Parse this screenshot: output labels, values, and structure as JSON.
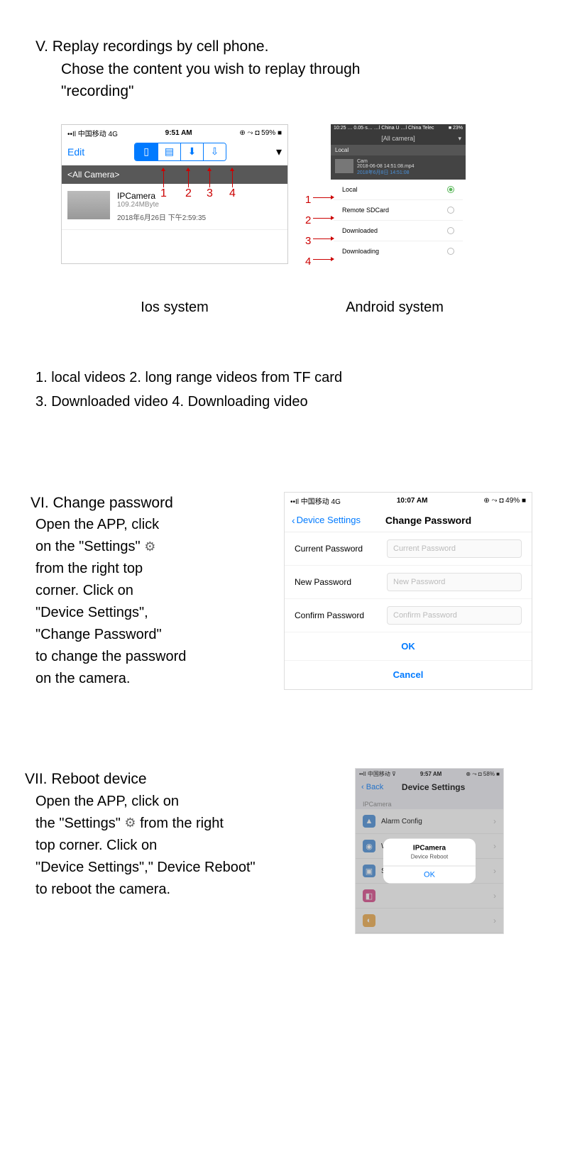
{
  "section5": {
    "heading_line1": "V.  Replay recordings by cell phone.",
    "heading_line2": "Chose the content you wish to replay through",
    "heading_line3": "\"recording\"",
    "ios_caption": "Ios system",
    "android_caption": "Android system",
    "legend1": "1.   local videos       2. long range videos from TF card",
    "legend2": "3.  Downloaded video       4.  Downloading video"
  },
  "ios_shot1": {
    "status_left": "••Il 中国移动  4G",
    "status_center": "9:51 AM",
    "status_right": "⊕ ⤳ ◘ 59% ■",
    "edit": "Edit",
    "breadcrumb": "<All Camera>",
    "video_name": "IPCamera",
    "video_size": "109.24MByte",
    "video_date": "2018年6月26日 下午2:59:35",
    "num1": "1",
    "num2": "2",
    "num3": "3",
    "num4": "4"
  },
  "android_shot": {
    "status_left": "10:25 … 0.05·s… …l China U  …l China Telec",
    "status_right": "■ 23%",
    "title": "[All camera]",
    "section": "Local",
    "item_name": "Cam",
    "item_line1": "2018-06-08 14:51:08.mp4",
    "item_line2": "2018年6月8日 14:51:08",
    "options": [
      "Local",
      "Remote SDCard",
      "Downloaded",
      "Downloading"
    ],
    "labels": [
      "1",
      "2",
      "3",
      "4"
    ]
  },
  "section6": {
    "heading": "VI. Change password",
    "body1": "Open the APP, click",
    "body2": "on the \"Settings\"",
    "body3": "from the right  top",
    "body4": "corner. Click on",
    "body5": "\"Device Settings\",",
    "body6": "\"Change Password\"",
    "body7": "to change the password",
    "body8": "on the camera."
  },
  "ios_shot2": {
    "status_left": "••Il 中国移动  4G",
    "status_center": "10:07 AM",
    "status_right": "⊕ ⤳ ◘ 49% ■",
    "back": "Device Settings",
    "title": "Change Password",
    "row1_label": "Current Password",
    "row1_ph": "Current Password",
    "row2_label": "New Password",
    "row2_ph": "New Password",
    "row3_label": "Confirm Password",
    "row3_ph": "Confirm Password",
    "ok": "OK",
    "cancel": "Cancel"
  },
  "section7": {
    "heading": "VII. Reboot device",
    "body1": "Open the APP, click on",
    "body2a": "the \"Settings\"",
    "body2b": "from the right",
    "body3": "top corner.  Click on",
    "body4": "\"Device Settings\",\" Device Reboot\"",
    "body5": "to reboot the camera."
  },
  "ios_shot3": {
    "status_left": "••Il 中国移动  ⊽",
    "status_center": "9:57 AM",
    "status_right": "⊕ ⤳ ◘ 58% ■",
    "back": "Back",
    "title": "Device Settings",
    "section": "IPCamera",
    "rows": [
      {
        "icon_bg": "#4a90d9",
        "label": "Alarm Config"
      },
      {
        "icon_bg": "#4a90d9",
        "label": "WiFi Config"
      },
      {
        "icon_bg": "#4a90d9",
        "label": "SD Card Record Config"
      },
      {
        "icon_bg": "#d94a8a",
        "label": ""
      },
      {
        "icon_bg": "#f0ad4e",
        "label": ""
      }
    ],
    "alert_title": "IPCamera",
    "alert_msg": "Device Reboot",
    "alert_ok": "OK"
  }
}
